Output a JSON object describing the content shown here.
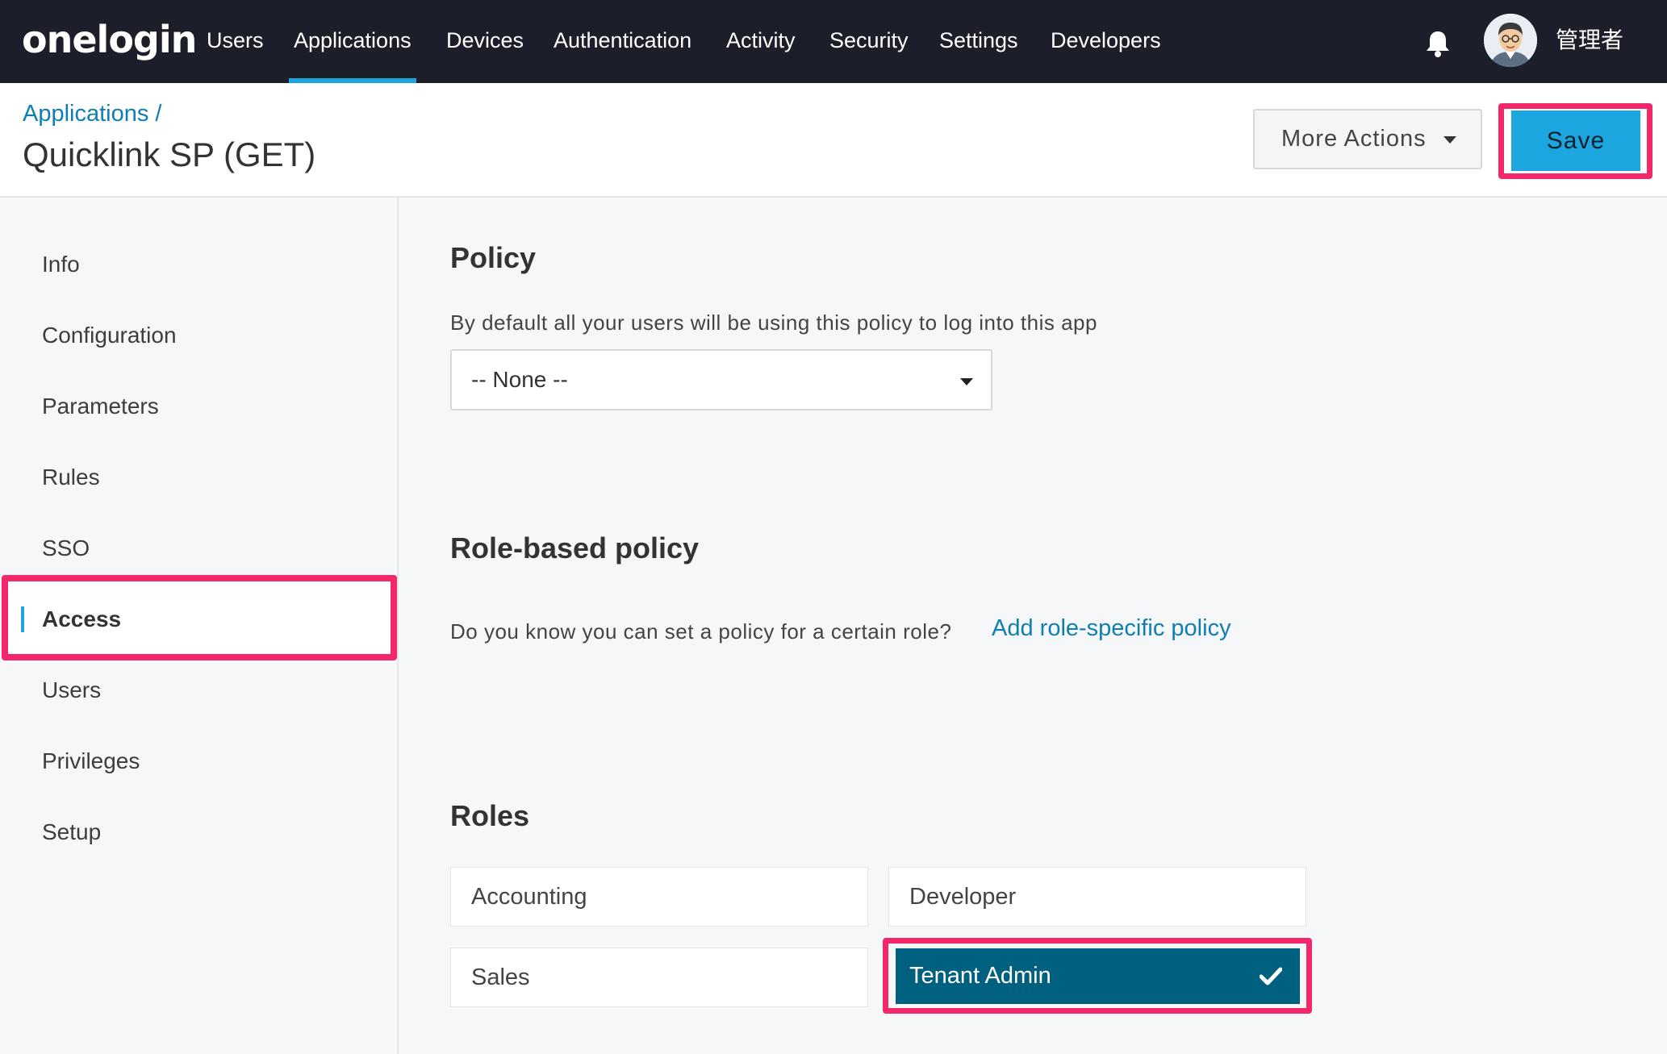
{
  "nav": {
    "logo": "onelogin",
    "items": [
      {
        "label": "Users"
      },
      {
        "label": "Applications"
      },
      {
        "label": "Devices"
      },
      {
        "label": "Authentication"
      },
      {
        "label": "Activity"
      },
      {
        "label": "Security"
      },
      {
        "label": "Settings"
      },
      {
        "label": "Developers"
      }
    ],
    "active_item": "Applications",
    "bell_icon": "bell-icon",
    "avatar_icon": "user-avatar",
    "username": "管理者"
  },
  "header": {
    "breadcrumb": "Applications /",
    "title": "Quicklink SP (GET)",
    "more_actions_label": "More Actions",
    "save_label": "Save"
  },
  "sidebar": {
    "items": [
      {
        "label": "Info"
      },
      {
        "label": "Configuration"
      },
      {
        "label": "Parameters"
      },
      {
        "label": "Rules"
      },
      {
        "label": "SSO"
      },
      {
        "label": "Access"
      },
      {
        "label": "Users"
      },
      {
        "label": "Privileges"
      },
      {
        "label": "Setup"
      }
    ],
    "active_item": "Access"
  },
  "policy": {
    "heading": "Policy",
    "description": "By default all your users will be using this policy to log into this app",
    "selected": "-- None --"
  },
  "role_policy": {
    "heading": "Role-based policy",
    "prompt": "Do you know you can set a policy for a certain role?",
    "link": "Add role-specific policy"
  },
  "roles": {
    "heading": "Roles",
    "items": [
      {
        "label": "Accounting",
        "selected": false
      },
      {
        "label": "Developer",
        "selected": false
      },
      {
        "label": "Sales",
        "selected": false
      },
      {
        "label": "Tenant Admin",
        "selected": true
      }
    ]
  },
  "colors": {
    "nav_bg": "#1c1f2a",
    "accent": "#1ba6e0",
    "link": "#0f7fb3",
    "selected_role": "#00607f",
    "highlight": "#f2286b"
  }
}
